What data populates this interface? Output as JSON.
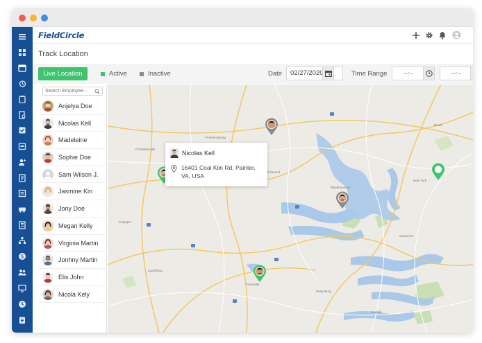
{
  "app": {
    "name": "FieldCircle"
  },
  "page": {
    "title": "Track Location"
  },
  "toolbar": {
    "live_label": "Live Location",
    "legend": [
      {
        "label": "Active",
        "color": "#3ec46d"
      },
      {
        "label": "Inactive",
        "color": "#8a8a8a"
      }
    ],
    "date_label": "Date",
    "date_value": "02/27/2020",
    "time_range_label": "Time Range",
    "time_from": "--:--",
    "time_to": "--:--"
  },
  "search": {
    "placeholder": "Search Employee..."
  },
  "employees": [
    {
      "name": "Anjelya Doe"
    },
    {
      "name": "Nicolas Kell"
    },
    {
      "name": "Madeleine"
    },
    {
      "name": "Sophie Doe"
    },
    {
      "name": "Sam Wilson J."
    },
    {
      "name": "Jasmine Kin"
    },
    {
      "name": "Jony Doe"
    },
    {
      "name": "Megan Kelly"
    },
    {
      "name": "Virginia Martin"
    },
    {
      "name": "Jonhny Martin"
    },
    {
      "name": "Elis John"
    },
    {
      "name": "Nicola Kely"
    }
  ],
  "popup": {
    "name": "Nicolas Kell",
    "address": "16401 Coal Kiln Rd, Painter, VA, USA"
  },
  "colors": {
    "sidebar": "#164f93",
    "active": "#3ec46d",
    "inactive": "#8a8a8a",
    "water": "#a9c8e8"
  }
}
